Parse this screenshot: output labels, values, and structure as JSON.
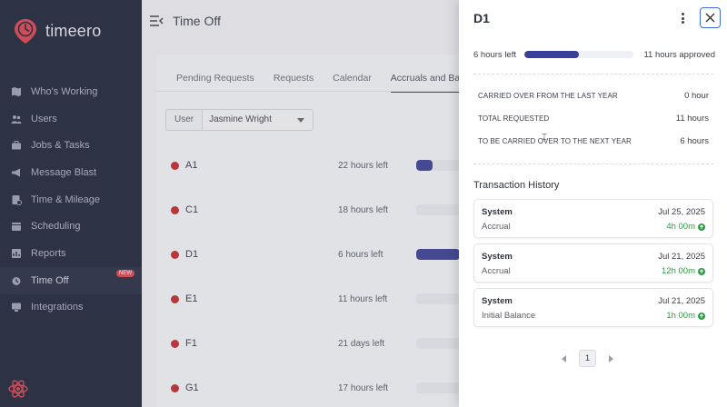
{
  "app": {
    "brand": "timeero",
    "page_title": "Time Off"
  },
  "sidebar": {
    "items": [
      {
        "label": "Who's Working",
        "icon": "map-pin-icon"
      },
      {
        "label": "Users",
        "icon": "users-icon"
      },
      {
        "label": "Jobs & Tasks",
        "icon": "briefcase-icon"
      },
      {
        "label": "Message Blast",
        "icon": "megaphone-icon"
      },
      {
        "label": "Time & Mileage",
        "icon": "timesheet-icon"
      },
      {
        "label": "Scheduling",
        "icon": "calendar-icon"
      },
      {
        "label": "Reports",
        "icon": "reports-icon"
      },
      {
        "label": "Time Off",
        "icon": "time-off-icon",
        "badge": "NEW"
      },
      {
        "label": "Integrations",
        "icon": "integrations-icon"
      }
    ]
  },
  "tabs": [
    "Pending Requests",
    "Requests",
    "Calendar",
    "Accruals and Balance"
  ],
  "filter": {
    "label": "User",
    "value": "Jasmine Wright"
  },
  "policies": [
    {
      "name": "A1",
      "left": "22 hours left",
      "fill": 0.3
    },
    {
      "name": "C1",
      "left": "18 hours left",
      "fill": 0
    },
    {
      "name": "D1",
      "left": "6 hours left",
      "fill": 0.8
    },
    {
      "name": "E1",
      "left": "11 hours left",
      "fill": 0
    },
    {
      "name": "F1",
      "left": "21 days left",
      "fill": 0
    },
    {
      "name": "G1",
      "left": "17 hours left",
      "fill": 0
    }
  ],
  "drawer": {
    "title": "D1",
    "hours_left": "6 hours left",
    "hours_approved": "11 hours approved",
    "progress": 0.5,
    "stats": [
      {
        "label": "CARRIED OVER FROM THE LAST YEAR",
        "value": "0 hour"
      },
      {
        "label": "TOTAL REQUESTED",
        "value": "11 hours"
      },
      {
        "label": "TO BE CARRIED OVER TO THE NEXT YEAR",
        "value": "6 hours"
      }
    ],
    "history_title": "Transaction History",
    "transactions": [
      {
        "who": "System",
        "date": "Jul 25, 2025",
        "type": "Accrual",
        "amount": "4h 00m"
      },
      {
        "who": "System",
        "date": "Jul 21, 2025",
        "type": "Accrual",
        "amount": "12h 00m"
      },
      {
        "who": "System",
        "date": "Jul 21, 2025",
        "type": "Initial Balance",
        "amount": "1h 00m"
      }
    ],
    "page": "1"
  },
  "colors": {
    "sidebar": "#1e2337",
    "accent": "#3a3f99",
    "brand": "#e0454f",
    "positive": "#2e9a45"
  }
}
